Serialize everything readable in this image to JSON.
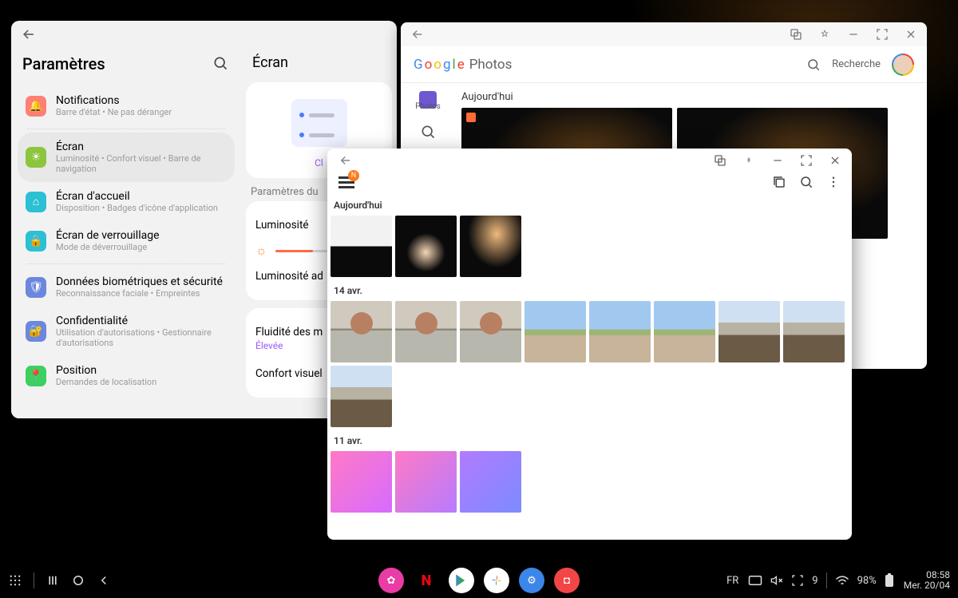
{
  "settings": {
    "title": "Paramètres",
    "items": [
      {
        "label": "Notifications",
        "sub": "Barre d'état  •  Ne pas déranger"
      },
      {
        "label": "Écran",
        "sub": "Luminosité  •  Confort visuel  •  Barre de navigation"
      },
      {
        "label": "Écran d'accueil",
        "sub": "Disposition  •  Badges d'icône d'application"
      },
      {
        "label": "Écran de verrouillage",
        "sub": "Mode de déverrouillage"
      },
      {
        "label": "Données biométriques et sécurité",
        "sub": "Reconnaissance faciale  •  Empreintes"
      },
      {
        "label": "Confidentialité",
        "sub": "Utilisation d'autorisations  •  Gestionnaire d'autorisations"
      },
      {
        "label": "Position",
        "sub": "Demandes de localisation"
      }
    ],
    "detail": {
      "title": "Écran",
      "preview_caption_truncated": "Cl",
      "section1_truncated": "Paramètres du",
      "brightness": "Luminosité",
      "brightness_adapt_truncated": "Luminosité ad",
      "fluidity_truncated": "Fluidité des m",
      "fluidity_value": "Élevée",
      "comfort_truncated": "Confort visuel"
    }
  },
  "gphotos": {
    "app_name_prefix": "Google",
    "app_name_suffix": "Photos",
    "search_label": "Recherche",
    "side_photos": "Photos",
    "today": "Aujourd'hui"
  },
  "gallery": {
    "badge": "N",
    "today": "Aujourd'hui",
    "date2": "14 avr.",
    "date3": "11 avr."
  },
  "taskbar": {
    "lang": "FR",
    "notif_count": "9",
    "battery": "98%",
    "time": "08:58",
    "date": "Mer. 20/04"
  }
}
